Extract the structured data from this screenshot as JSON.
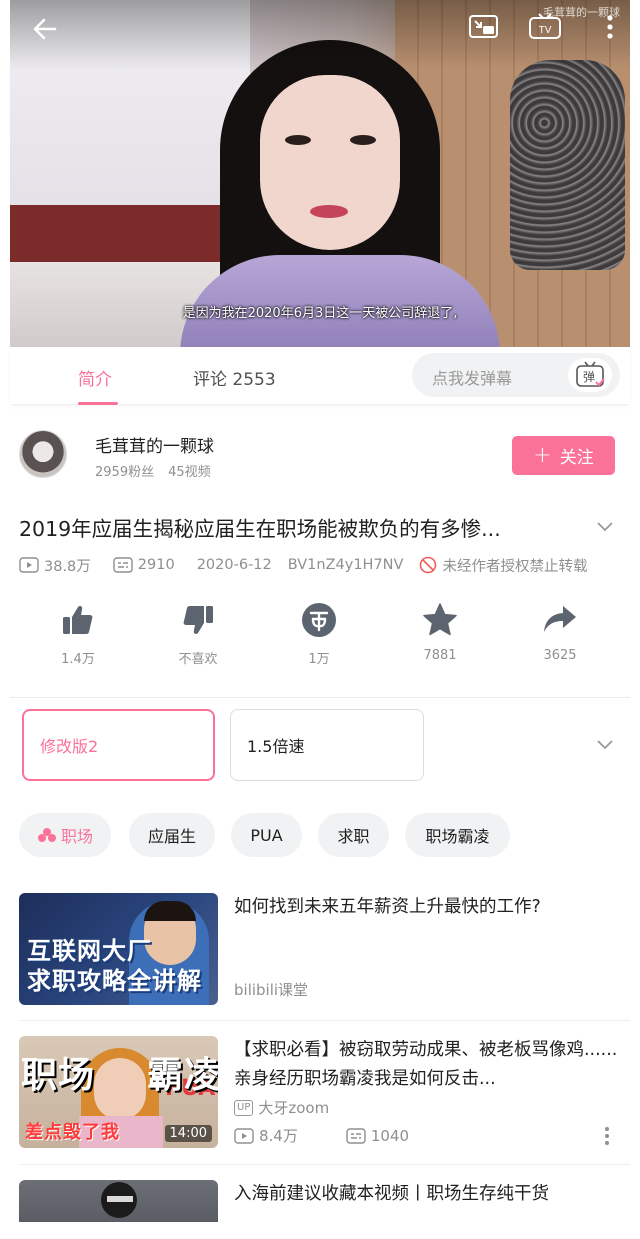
{
  "player": {
    "watermark": "毛茸茸的一颗球",
    "subtitle": "是因为我在2020年6月3日这一天被公司辞退了,",
    "icons": [
      "back-arrow-icon",
      "mini-window-icon",
      "tv-cast-icon",
      "more-vertical-icon"
    ]
  },
  "tabs": {
    "intro": "简介",
    "comments": "评论 2553",
    "danmaku_placeholder": "点我发弹幕",
    "danmaku_icon_text": "弹"
  },
  "uploader": {
    "name": "毛茸茸的一颗球",
    "followers": "2959粉丝",
    "videos": "45视频",
    "follow_label": "关注"
  },
  "video": {
    "title": "2019年应届生揭秘应届生在职场能被欺负的有多惨...",
    "views": "38.8万",
    "danmaku_count": "2910",
    "date": "2020-6-12",
    "bvid": "BV1nZ4y1H7NV",
    "copyright": "未经作者授权禁止转载"
  },
  "actions": [
    {
      "icon": "thumbs-up-icon",
      "label": "1.4万"
    },
    {
      "icon": "thumbs-down-icon",
      "label": "不喜欢"
    },
    {
      "icon": "coin-icon",
      "label": "1万"
    },
    {
      "icon": "star-icon",
      "label": "7881"
    },
    {
      "icon": "share-icon",
      "label": "3625"
    }
  ],
  "episodes": [
    {
      "label": "修改版2",
      "selected": true
    },
    {
      "label": "1.5倍速",
      "selected": false
    }
  ],
  "tags": [
    "职场",
    "应届生",
    "PUA",
    "求职",
    "职场霸凌"
  ],
  "recommendations": [
    {
      "title": "如何找到未来五年薪资上升最快的工作?",
      "thumb_line1": "互联网大厂",
      "thumb_line2": "求职攻略全讲解",
      "author": "bilibili课堂"
    },
    {
      "title": "【求职必看】被窃取劳动成果、被老板骂像鸡......亲身经历职场霸凌我是如何反击...",
      "thumb_line1": "职场",
      "thumb_line1b": "霸凌",
      "thumb_line2": "差点毁了我",
      "thumb_pua": "PUA",
      "duration": "14:00",
      "up_badge": "UP",
      "author": "大牙zoom",
      "views": "8.4万",
      "danmaku": "1040"
    },
    {
      "title": "入海前建议收藏本视频丨职场生存纯干货"
    }
  ],
  "colors": {
    "accent": "#fb7299",
    "muted": "#8f8f8f",
    "text": "#212121"
  }
}
